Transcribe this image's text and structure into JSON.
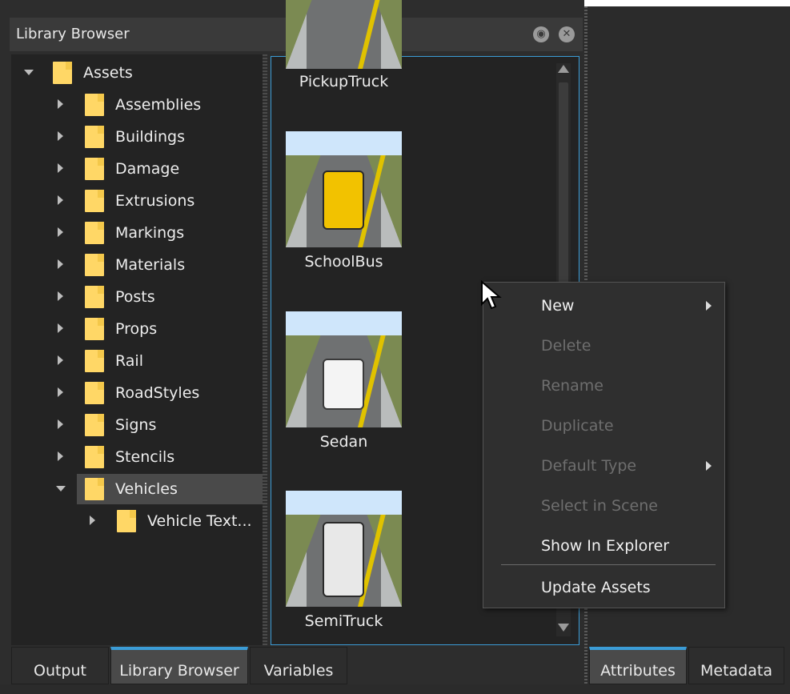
{
  "panel": {
    "title": "Library Browser"
  },
  "tree": {
    "root": "Assets",
    "items": [
      {
        "label": "Assemblies"
      },
      {
        "label": "Buildings"
      },
      {
        "label": "Damage"
      },
      {
        "label": "Extrusions"
      },
      {
        "label": "Markings"
      },
      {
        "label": "Materials"
      },
      {
        "label": "Posts"
      },
      {
        "label": "Props"
      },
      {
        "label": "Rail"
      },
      {
        "label": "RoadStyles"
      },
      {
        "label": "Signs"
      },
      {
        "label": "Stencils"
      },
      {
        "label": "Vehicles"
      }
    ],
    "child": "Vehicle Text..."
  },
  "assets": [
    {
      "label": "PickupTruck"
    },
    {
      "label": "SchoolBus"
    },
    {
      "label": "Sedan"
    },
    {
      "label": "SemiTruck"
    }
  ],
  "context_menu": {
    "items": [
      {
        "label": "New",
        "enabled": true,
        "submenu": true
      },
      {
        "label": "Delete",
        "enabled": false
      },
      {
        "label": "Rename",
        "enabled": false
      },
      {
        "label": "Duplicate",
        "enabled": false
      },
      {
        "label": "Default Type",
        "enabled": false,
        "submenu": true
      },
      {
        "label": "Select in Scene",
        "enabled": false
      },
      {
        "label": "Show In Explorer",
        "enabled": true
      },
      {
        "label": "Update Assets",
        "enabled": true
      }
    ]
  },
  "tabs": {
    "left": [
      "Output",
      "Library Browser",
      "Variables"
    ],
    "right": [
      "Attributes",
      "Metadata"
    ]
  },
  "colors": {
    "accent": "#3b9cd6",
    "folder": "#ffd766",
    "school_bus": "#f2c200",
    "sedan": "#f4f4f4",
    "semi_truck": "#e8e8e8"
  }
}
